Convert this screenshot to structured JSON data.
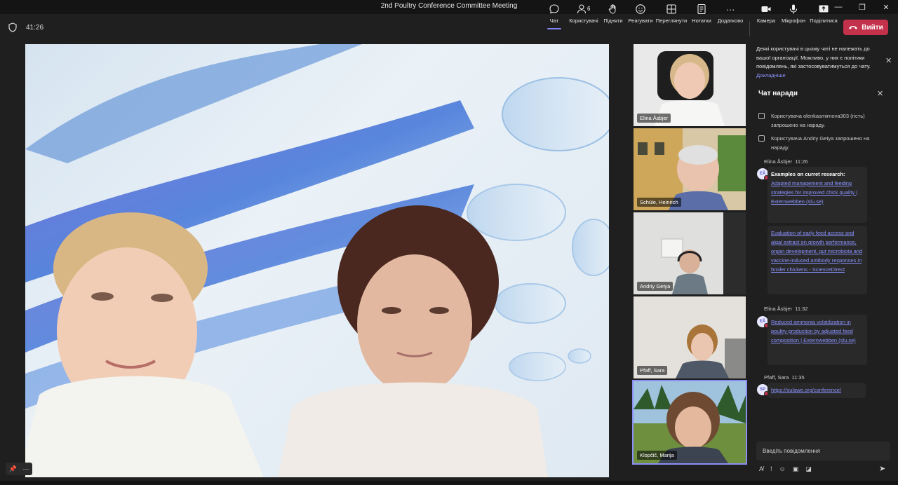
{
  "window": {
    "title": "2nd Poultry Conference Committee Meeting"
  },
  "meeting": {
    "timer": "41:26"
  },
  "toolbar": {
    "chat": "Чат",
    "people": "Користувачі",
    "people_count": "6",
    "raise": "Підняти",
    "react": "Реагувати",
    "view": "Переглянути",
    "notes": "Нотатки",
    "more": "Додатково",
    "camera": "Камера",
    "mic": "Мікрофон",
    "share": "Поділитися",
    "leave": "Вийти"
  },
  "participants": [
    {
      "name": "Elina Åsbjer"
    },
    {
      "name": "Schüle, Heinrich"
    },
    {
      "name": "Andriy Getya"
    },
    {
      "name": "Pfaff, Sara"
    },
    {
      "name": "Klopčič, Marija"
    }
  ],
  "notice": {
    "text": "Деякі користувачі в цьому чаті не належать до вашої організації. Можливо, у них є політики повідомлень, які застосовуватимуться до чату.",
    "link": "Докладніше"
  },
  "chat": {
    "header": "Чат наради",
    "system_messages": [
      "Користувача olenkasmirnova303 (гість) запрошено на нараду.",
      "Користувача Andriy Getya запрошено на нараду."
    ],
    "messages": [
      {
        "sender": "Elina Åsbjer",
        "time": "11:26",
        "initials": "EÅ",
        "heading": "Examples on curret research:",
        "link1": "Adapted management and feeding strategies for improved chick quality | Externwebben (slu.se)",
        "link2": "Evaluation of early feed access and algal extract on growth performance, organ development, gut microbiota and vaccine-induced antibody responses in broiler chickens - ScienceDirect"
      },
      {
        "sender": "Elina Åsbjer",
        "time": "11:32",
        "initials": "EÅ",
        "link1": "Reduced ammonia volatilization in poultry production by adjusted feed composition | Externwebben (slu.se)"
      },
      {
        "sender": "Pfaff, Sara",
        "time": "11:35",
        "initials": "SP",
        "link1": "https://sulawe.org/conference/"
      }
    ],
    "compose_placeholder": "Введіть повідомлення"
  }
}
